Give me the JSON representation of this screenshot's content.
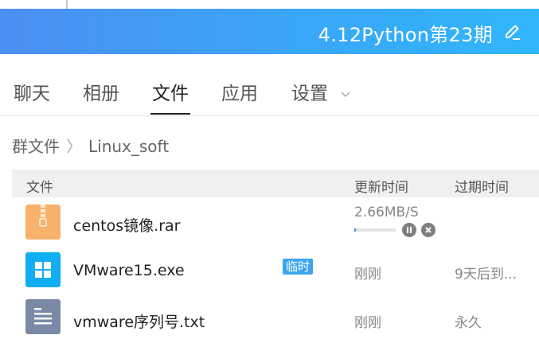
{
  "header": {
    "title": "4.12Python第23期",
    "edit_icon": "edit-pencil-icon"
  },
  "tabs": [
    {
      "label": "聊天"
    },
    {
      "label": "相册"
    },
    {
      "label": "文件",
      "active": true
    },
    {
      "label": "应用"
    },
    {
      "label": "设置",
      "has_dropdown": true
    }
  ],
  "breadcrumb": {
    "root": "群文件",
    "separator": "〉",
    "current": "Linux_soft"
  },
  "table": {
    "columns": {
      "file": "文件",
      "updated": "更新时间",
      "expire": "过期时间"
    },
    "rows": [
      {
        "icon": "zip-archive-icon",
        "icon_color": "#f6b26b",
        "name": "centos镜像.rar",
        "speed": "2.66MB/S",
        "progress": 0.04,
        "status": "downloading"
      },
      {
        "icon": "windows-exe-icon",
        "icon_color": "#10aef2",
        "name": "VMware15.exe",
        "badge": "临时",
        "updated": "刚刚",
        "expire": "9天后到..."
      },
      {
        "icon": "text-file-icon",
        "icon_color": "#7a8aa6",
        "name": "vmware序列号.txt",
        "updated": "刚刚",
        "expire": "永久"
      }
    ]
  },
  "colors": {
    "header_start": "#4b8ff2",
    "header_end": "#30b6fb",
    "accent": "#3ba5ee"
  }
}
